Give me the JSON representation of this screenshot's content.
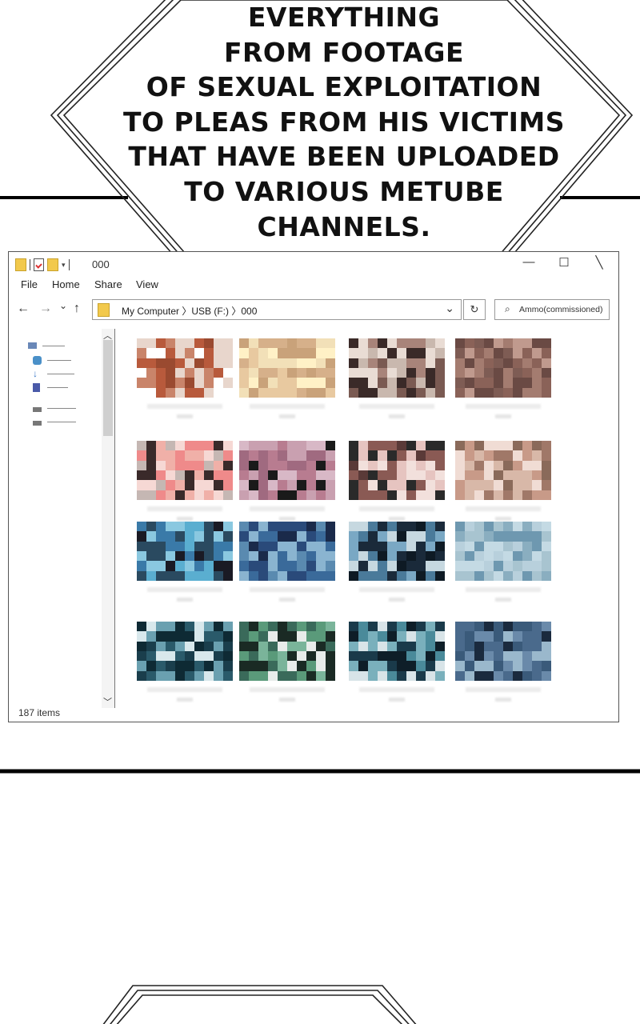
{
  "speech_bubble": {
    "lines": [
      "EVERYTHING",
      "FROM FOOTAGE",
      "OF SEXUAL EXPLOITATION",
      "TO PLEAS FROM HIS VICTIMS",
      "THAT HAVE BEEN UPLOADED",
      "TO VARIOUS METUBE",
      "CHANNELS."
    ]
  },
  "explorer": {
    "title": "000",
    "controls": {
      "minimize": "—",
      "maximize": "☐",
      "close": "╲"
    },
    "menu": [
      "File",
      "Home",
      "Share",
      "View"
    ],
    "nav": {
      "back": "←",
      "forward": "→",
      "recent": "⌄",
      "up": "↑"
    },
    "address": "My Computer 〉USB (F:) 〉000",
    "address_dropdown": "⌄",
    "refresh": "↻",
    "search_placeholder": "Ammo(commissioned)",
    "search_icon": "⌕",
    "status": "187 items",
    "nav_pane_icons": [
      "monitor-icon",
      "shield-icon",
      "download-icon",
      "doc-icon",
      "drive-icon",
      "drive-icon"
    ],
    "thumbnail_count": 16,
    "palettes": [
      [
        "#b85a3c",
        "#c9846a",
        "#e8d6cc",
        "#ffffff",
        "#9a4a30"
      ],
      [
        "#e8c9a0",
        "#f2e0b8",
        "#d6b08a",
        "#fff1c6",
        "#c9a27a"
      ],
      [
        "#e9dcd4",
        "#a8847a",
        "#3a2a28",
        "#c9b8ae",
        "#7a5a52"
      ],
      [
        "#8a6258",
        "#a47c70",
        "#6a4a44",
        "#c09a8e",
        "#7e5c54"
      ],
      [
        "#c5b7b3",
        "#ef8a8a",
        "#f6d8d4",
        "#3a2a2a",
        "#f0b0a8"
      ],
      [
        "#b87c90",
        "#c9a0b0",
        "#a06a80",
        "#1a1a1a",
        "#d8b8c6"
      ],
      [
        "#2a2a2a",
        "#e6c4c0",
        "#8a5a54",
        "#f2e0dc",
        "#5a3a38"
      ],
      [
        "#d8b8a8",
        "#f0dcd4",
        "#a07868",
        "#c89a88",
        "#8a6a5a"
      ],
      [
        "#5aaed0",
        "#2a4a60",
        "#1a1a24",
        "#8ac8e0",
        "#3a7aa8"
      ],
      [
        "#2a4a7a",
        "#5a8ab0",
        "#1a2a4a",
        "#8ab4d0",
        "#3a6a9a"
      ],
      [
        "#1a2a3a",
        "#7aa8c4",
        "#c6d8e0",
        "#4a7a9a",
        "#0e1a24"
      ],
      [
        "#a8c4d0",
        "#8aaec0",
        "#c4dae4",
        "#6e98b0",
        "#b8d0dc"
      ],
      [
        "#2a5a6a",
        "#0e2a34",
        "#6aa0b0",
        "#d8e8ec",
        "#1a3e4c"
      ],
      [
        "#5a9a7a",
        "#7ab49a",
        "#e8ecea",
        "#3a6a5a",
        "#1a2a24"
      ],
      [
        "#1a3a4a",
        "#4a8a9a",
        "#d8e4e8",
        "#0e1e28",
        "#7ab0bc"
      ],
      [
        "#3a5a7a",
        "#6a8aaa",
        "#1a2a3e",
        "#9ab8cc",
        "#4a6a8c"
      ]
    ]
  }
}
